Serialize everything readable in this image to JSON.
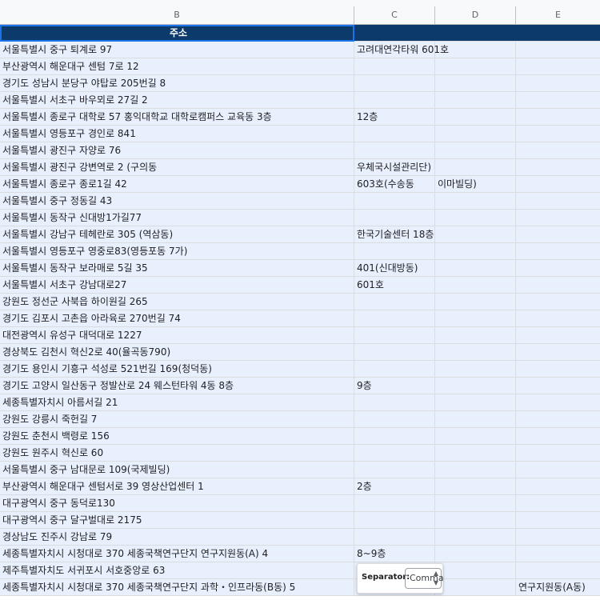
{
  "colors": {
    "header_bg": "#0b3a6b",
    "row_selected": "#e8f0fe",
    "gridline": "#dadce0",
    "selection_border": "#1a73e8"
  },
  "columns": [
    "B",
    "C",
    "D",
    "E"
  ],
  "header": {
    "b": "주소",
    "c": "",
    "d": "",
    "e": ""
  },
  "rows": [
    {
      "b": "서울특별시 중구 퇴계로 97",
      "c": "고려대연각타워 601호",
      "d": "",
      "e": ""
    },
    {
      "b": "부산광역시 해운대구 센텀 7로 12",
      "c": "",
      "d": "",
      "e": ""
    },
    {
      "b": "경기도 성남시 분당구 야탑로 205번길 8",
      "c": "",
      "d": "",
      "e": ""
    },
    {
      "b": "서울특별시 서초구 바우뫼로 27길 2",
      "c": "",
      "d": "",
      "e": ""
    },
    {
      "b": "서울특별시 종로구 대학로 57 홍익대학교 대학로캠퍼스 교육동 3층",
      "c": "12층",
      "d": "",
      "e": ""
    },
    {
      "b": "서울특별시 영등포구 경인로 841",
      "c": "",
      "d": "",
      "e": ""
    },
    {
      "b": "서울특별시 광진구 자양로 76",
      "c": "",
      "d": "",
      "e": ""
    },
    {
      "b": "서울특별시 광진구 강변역로 2 (구의동",
      "c": "우체국시설관리단)",
      "d": "",
      "e": ""
    },
    {
      "b": "서울특별시 종로구 종로1길 42",
      "c": "603호(수송동",
      "d": "이마빌딩)",
      "e": ""
    },
    {
      "b": "서울특별시 중구 정동길 43",
      "c": "",
      "d": "",
      "e": ""
    },
    {
      "b": "서울특별시 동작구 신대방1가길77",
      "c": "",
      "d": "",
      "e": ""
    },
    {
      "b": "서울특별시 강남구 테헤란로 305 (역삼동)",
      "c": "한국기술센터 18층",
      "d": "",
      "e": ""
    },
    {
      "b": "서울특별시 영등포구 영중로83(영등포동 7가)",
      "c": "",
      "d": "",
      "e": ""
    },
    {
      "b": "서울특별시 동작구 보라매로 5길 35",
      "c": "401(신대방동)",
      "d": "",
      "e": ""
    },
    {
      "b": "서울특별시 서초구 강남대로27",
      "c": "601호",
      "d": "",
      "e": ""
    },
    {
      "b": "강원도 정선군 사북읍 하이원길 265",
      "c": "",
      "d": "",
      "e": ""
    },
    {
      "b": "경기도 김포시 고촌읍 아라육로 270번길 74",
      "c": "",
      "d": "",
      "e": ""
    },
    {
      "b": "대전광역시 유성구 대덕대로 1227",
      "c": "",
      "d": "",
      "e": ""
    },
    {
      "b": "경상북도 김천시 혁신2로 40(율곡동790)",
      "c": "",
      "d": "",
      "e": ""
    },
    {
      "b": "경기도 용인시 기흥구 석성로 521번길 169(청덕동)",
      "c": "",
      "d": "",
      "e": ""
    },
    {
      "b": "경기도 고양시 일산동구 정발산로 24 웨스턴타워 4동 8층",
      "c": "9층",
      "d": "",
      "e": ""
    },
    {
      "b": "세종특별자치시 아름서길 21",
      "c": "",
      "d": "",
      "e": ""
    },
    {
      "b": "강원도 강릉시 죽헌길 7",
      "c": "",
      "d": "",
      "e": ""
    },
    {
      "b": "강원도 춘천시 백령로 156",
      "c": "",
      "d": "",
      "e": ""
    },
    {
      "b": "강원도 원주시 혁신로 60",
      "c": "",
      "d": "",
      "e": ""
    },
    {
      "b": "서울특별시 중구 남대문로 109(국제빌딩)",
      "c": "",
      "d": "",
      "e": ""
    },
    {
      "b": "부산광역시 해운대구 센텀서로 39 영상산업센터 1",
      "c": "2층",
      "d": "",
      "e": ""
    },
    {
      "b": "대구광역시 중구 동덕로130",
      "c": "",
      "d": "",
      "e": ""
    },
    {
      "b": "대구광역시 중구 달구벌대로 2175",
      "c": "",
      "d": "",
      "e": ""
    },
    {
      "b": "경상남도 진주시 강남로 79",
      "c": "",
      "d": "",
      "e": ""
    },
    {
      "b": "세종특별자치시 시청대로 370 세종국책연구단지 연구지원동(A) 4",
      "c": "8~9층",
      "d": "",
      "e": ""
    },
    {
      "b": "제주특별자치도 서귀포시 서호중앙로 63",
      "c": "",
      "d": "",
      "e": ""
    },
    {
      "b": "세종특별자치시 시청대로 370 세종국책연구단지 과학・인프라동(B동) 5",
      "c": "",
      "d": "",
      "e": "연구지원동(A동)"
    }
  ],
  "separator_popup": {
    "label": "Separator:",
    "selected": "Comma",
    "chevron_icon": "up-down-chevron-icon"
  }
}
